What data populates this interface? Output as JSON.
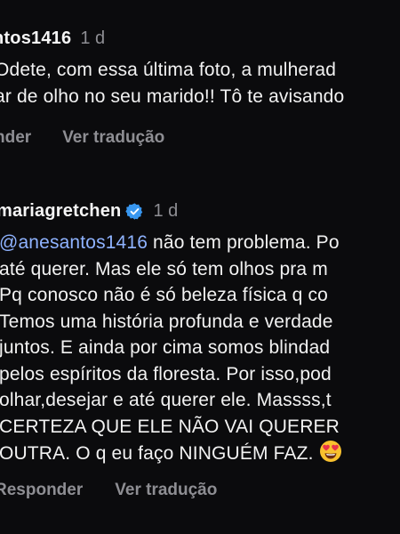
{
  "comments": [
    {
      "username": "ntos1416",
      "time": "1 d",
      "lines": [
        "Odete, com essa última foto, a mulherad",
        "ar de olho no seu marido!! Tô te avisando"
      ],
      "reply_label": "nder",
      "translate_label": "Ver tradução"
    },
    {
      "username": "mariagretchen",
      "time": "1 d",
      "mention": "@anesantos1416",
      "line1_rest": " não tem problema. Po",
      "lines": [
        "até querer. Mas ele só tem olhos pra m",
        "Pq conosco não é só beleza física q co",
        "Temos uma história profunda e verdade",
        "juntos. E ainda por cima somos blindad",
        "pelos espíritos da floresta. Por isso,pod",
        "olhar,desejar e até querer ele. Massss,t",
        "CERTEZA QUE ELE NÃO VAI QUERER",
        "OUTRA. O q eu faço NINGUÉM FAZ."
      ],
      "emoji_icon": "smiling-face-with-heart-eyes-icon",
      "reply_label": "Responder",
      "translate_label": "Ver tradução"
    }
  ],
  "colors": {
    "background": "#0b0b0d",
    "text": "#f2f2f2",
    "muted": "#8e8e93",
    "mention": "#8fb3ff",
    "verified": "#3897f0"
  }
}
